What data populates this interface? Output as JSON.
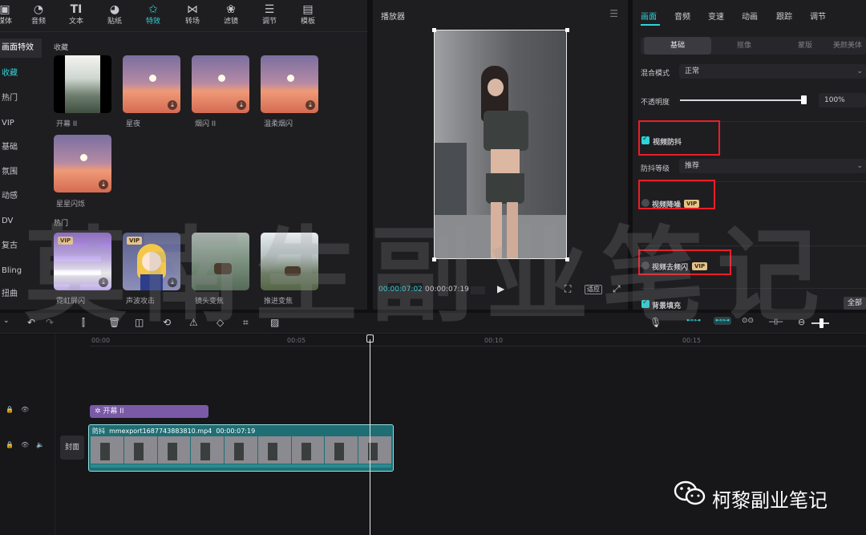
{
  "toolbar": {
    "items": [
      {
        "label": "媒体",
        "icon": "media-icon"
      },
      {
        "label": "音频",
        "icon": "audio-icon"
      },
      {
        "label": "文本",
        "icon": "text-icon"
      },
      {
        "label": "贴纸",
        "icon": "sticker-icon"
      },
      {
        "label": "特效",
        "icon": "effects-icon",
        "active": true
      },
      {
        "label": "转场",
        "icon": "transition-icon"
      },
      {
        "label": "滤镜",
        "icon": "filter-icon"
      },
      {
        "label": "调节",
        "icon": "adjust-icon"
      },
      {
        "label": "模板",
        "icon": "template-icon"
      }
    ]
  },
  "categories": [
    "画面特效",
    "收藏",
    "热门",
    "VIP",
    "基础",
    "氛围",
    "动感",
    "DV",
    "复古",
    "Bling",
    "扭曲"
  ],
  "effects": {
    "favorites_title": "收藏",
    "favorites": [
      {
        "label": "开幕 II"
      },
      {
        "label": "星夜"
      },
      {
        "label": "烟闪 II"
      },
      {
        "label": "温柔烟闪"
      },
      {
        "label": "星星闪烁"
      }
    ],
    "hot_title": "热门",
    "hot": [
      {
        "label": "霓虹屏闪",
        "vip": "VIP"
      },
      {
        "label": "声波攻击",
        "vip": "VIP"
      },
      {
        "label": "镜头变焦"
      },
      {
        "label": "推进变焦"
      }
    ]
  },
  "player": {
    "title": "播放器",
    "current_time": "00:00:07:02",
    "total_time": "00:00:07:19",
    "ratio_label": "适应"
  },
  "inspector": {
    "tabs": [
      "画面",
      "音频",
      "变速",
      "动画",
      "跟踪",
      "调节"
    ],
    "subtabs": [
      "基础",
      "抠像",
      "蒙版",
      "美颜美体"
    ],
    "blend_label": "混合模式",
    "blend_value": "正常",
    "opacity_label": "不透明度",
    "opacity_value": "100%",
    "stabilize_label": "视频防抖",
    "stabilize_level_label": "防抖等级",
    "stabilize_level_value": "推荐",
    "denoise_label": "视频降噪",
    "deflicker_label": "视频去频闪",
    "vip_badge": "VIP",
    "bg_fill_label": "背景填充",
    "apply_all": "全部",
    "accent": "#2fd3d8"
  },
  "timeline": {
    "ticks": [
      "00:00",
      "00:05",
      "00:10",
      "00:15"
    ],
    "effect_clip": "开幕 II",
    "video_clip_tag": "防抖",
    "video_clip_name": "mmexport1687743883810.mp4",
    "video_clip_duration": "00:00:07:19",
    "cover_label": "封面"
  },
  "watermarks": {
    "big": "莫南生副业笔记",
    "wechat": "柯黎副业笔记"
  }
}
